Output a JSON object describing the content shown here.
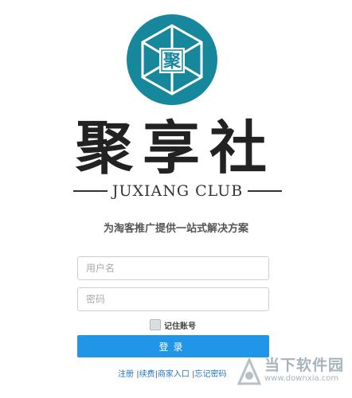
{
  "brand": {
    "emblem_char": "聚",
    "name": "聚享社",
    "name_en": "JUXIANG CLUB",
    "tagline": "为淘客推广提供一站式解决方案"
  },
  "form": {
    "username_placeholder": "用户名",
    "password_placeholder": "密码",
    "remember_label": "记住账号",
    "remember_checked": false,
    "login_label": "登录"
  },
  "links": {
    "register": "注册",
    "sep": "|",
    "renew": "续费",
    "merchant": "商家入口",
    "forgot": "忘记密码"
  },
  "watermark": {
    "text": "当下软件园",
    "url": "www.downxia.com"
  },
  "colors": {
    "accent": "#2196e8",
    "emblem": "#17879c"
  }
}
